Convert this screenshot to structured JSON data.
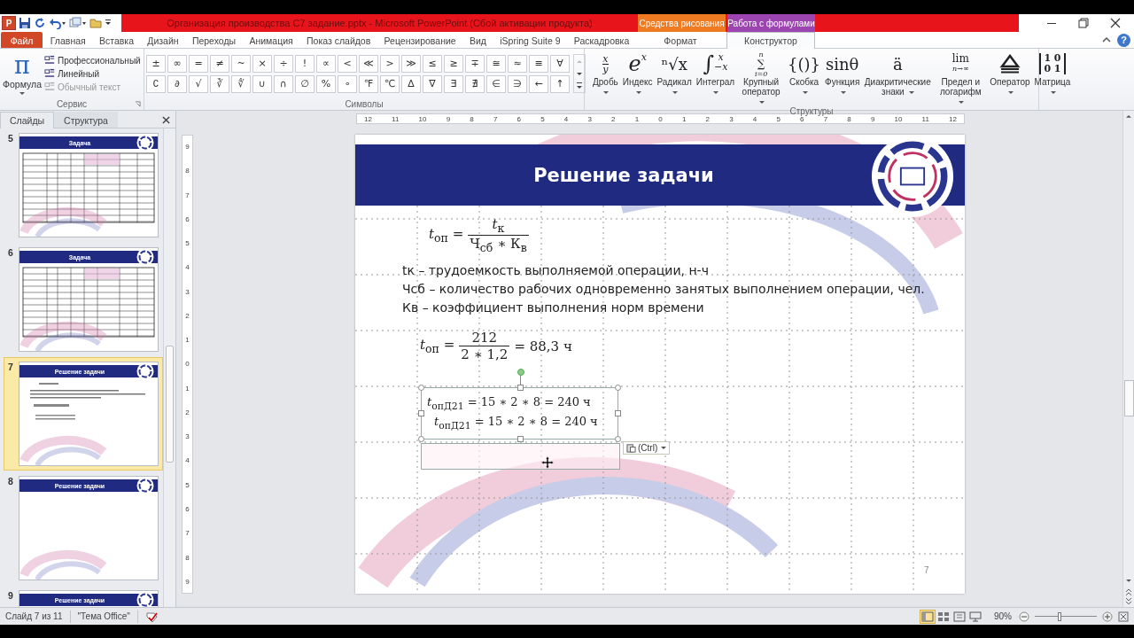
{
  "title_bar": {
    "app_letter": "P",
    "title": "Организация производства С7 задание.pptx  -  Microsoft PowerPoint (Сбой активации продукта)",
    "context_groups": [
      {
        "label": "Средства рисования",
        "color": "#ee7a22"
      },
      {
        "label": "Работа с формулами",
        "color": "#9c45b0"
      }
    ]
  },
  "tabs": [
    {
      "label": "Файл",
      "kind": "file",
      "selected": false
    },
    {
      "label": "Главная",
      "kind": "normal",
      "selected": false
    },
    {
      "label": "Вставка",
      "kind": "normal",
      "selected": false
    },
    {
      "label": "Дизайн",
      "kind": "normal",
      "selected": false
    },
    {
      "label": "Переходы",
      "kind": "normal",
      "selected": false
    },
    {
      "label": "Анимация",
      "kind": "normal",
      "selected": false
    },
    {
      "label": "Показ слайдов",
      "kind": "normal",
      "selected": false
    },
    {
      "label": "Рецензирование",
      "kind": "normal",
      "selected": false
    },
    {
      "label": "Вид",
      "kind": "normal",
      "selected": false
    },
    {
      "label": "iSpring Suite 9",
      "kind": "normal",
      "selected": false
    },
    {
      "label": "Раскадровка",
      "kind": "normal",
      "selected": false
    },
    {
      "label": "Формат",
      "kind": "context",
      "selected": false
    },
    {
      "label": "Конструктор",
      "kind": "context",
      "selected": true
    }
  ],
  "help": "?",
  "ribbon": {
    "service": {
      "label": "Сервис",
      "formula": {
        "glyph": "π",
        "label": "Формула"
      },
      "options": [
        {
          "label": "Профессиональный",
          "disabled": false
        },
        {
          "label": "Линейный",
          "disabled": false
        },
        {
          "label": "Обычный текст",
          "disabled": true
        }
      ]
    },
    "symbols": {
      "label": "Символы",
      "rows": [
        [
          "±",
          "∞",
          "=",
          "≠",
          "~",
          "×",
          "÷",
          "!",
          "∝",
          "<",
          "≪",
          ">",
          "≫",
          "≤",
          "≥",
          "∓",
          "≅",
          "≈",
          "≡",
          "∀"
        ],
        [
          "∁",
          "∂",
          "√",
          "∛",
          "∜",
          "∪",
          "∩",
          "∅",
          "%",
          "∘",
          "℉",
          "℃",
          "∆",
          "∇",
          "∃",
          "∄",
          "∈",
          "∋",
          "←",
          "↑"
        ]
      ]
    },
    "structures": {
      "label": "Структуры",
      "items": [
        {
          "label": "Дробь",
          "kind": "stack",
          "top": "x",
          "bottom": "y"
        },
        {
          "label": "Индекс",
          "kind": "script",
          "base": "e",
          "sup": "x"
        },
        {
          "label": "Радикал",
          "kind": "glyph",
          "glyph": "ⁿ√x"
        },
        {
          "label": "Интеграл",
          "kind": "script",
          "base": "∫",
          "sup": "x",
          "sub": "−x"
        },
        {
          "label": "Крупный оператор",
          "kind": "limits",
          "top": "n",
          "base": "∑",
          "bottom": "i=0"
        },
        {
          "label": "Скобка",
          "kind": "glyph",
          "glyph": "{()}"
        },
        {
          "label": "Функция",
          "kind": "glyph",
          "glyph": "sinθ"
        },
        {
          "label": "Диакритические знаки",
          "kind": "glyph",
          "glyph": "ä"
        },
        {
          "label": "Предел и логарифм",
          "kind": "limits",
          "base": "lim",
          "bottom": "n→∞"
        },
        {
          "label": "Оператор",
          "kind": "icon"
        },
        {
          "label": "Матрица",
          "kind": "matrix",
          "top": "1 0",
          "bottom": "0 1"
        }
      ]
    }
  },
  "panel": {
    "tabs": [
      {
        "label": "Слайды",
        "selected": true
      },
      {
        "label": "Структура",
        "selected": false
      }
    ],
    "thumbnails": [
      {
        "number": "5",
        "title": "Задача",
        "kind": "table",
        "selected": false
      },
      {
        "number": "6",
        "title": "Задача",
        "kind": "table",
        "selected": false
      },
      {
        "number": "7",
        "title": "Решение задачи",
        "kind": "text",
        "selected": true
      },
      {
        "number": "8",
        "title": "Решение задачи",
        "kind": "blank",
        "selected": false
      },
      {
        "number": "9",
        "title": "Решение задачи",
        "kind": "blank",
        "selected": false
      }
    ]
  },
  "h_ruler": [
    "12",
    "11",
    "10",
    "9",
    "8",
    "7",
    "6",
    "5",
    "4",
    "3",
    "2",
    "1",
    "0",
    "1",
    "2",
    "3",
    "4",
    "5",
    "6",
    "7",
    "8",
    "9",
    "10",
    "11",
    "12"
  ],
  "v_ruler": [
    "9",
    "8",
    "7",
    "6",
    "5",
    "4",
    "3",
    "2",
    "1",
    "0",
    "1",
    "2",
    "3",
    "4",
    "5",
    "6",
    "7",
    "8",
    "9"
  ],
  "slide": {
    "title": "Решение задачи",
    "formula_1": {
      "lhs": "*t*$_{оп}$ =",
      "numerator": "*t*$_{к}$",
      "denominator": "Ч$_{сб}$ ∗ К$_{в}$"
    },
    "definitions": [
      "tк – трудоемкость выполняемой операции, н-ч",
      "Чсб – количество рабочих одновременно занятых выполнением операции, чел.",
      "Кв – коэффициент выполнения норм времени"
    ],
    "formula_2": {
      "lhs": "*t*$_{оп}$ =",
      "numerator": "212",
      "denominator": "2 ∗ 1,2",
      "rhs": "= 88,3 ч"
    },
    "selected_box": [
      "*t*$_{опД21}$ = 15 ∗ 2 ∗ 8 = 240 ч",
      "*t*$_{опД21}$ = 15 ∗ 2 ∗ 8 = 240 ч"
    ],
    "paste_button": "(Ctrl)",
    "page_number": "7"
  },
  "status_bar": {
    "slide": "Слайд 7 из 11",
    "theme": "\"Тема Office\"",
    "views": [
      {
        "kind": "normal",
        "selected": true
      },
      {
        "kind": "sorter",
        "selected": false
      },
      {
        "kind": "reading",
        "selected": false
      },
      {
        "kind": "show",
        "selected": false
      }
    ],
    "zoom": "90%",
    "zoom_slider": {
      "level": 0.4
    }
  }
}
